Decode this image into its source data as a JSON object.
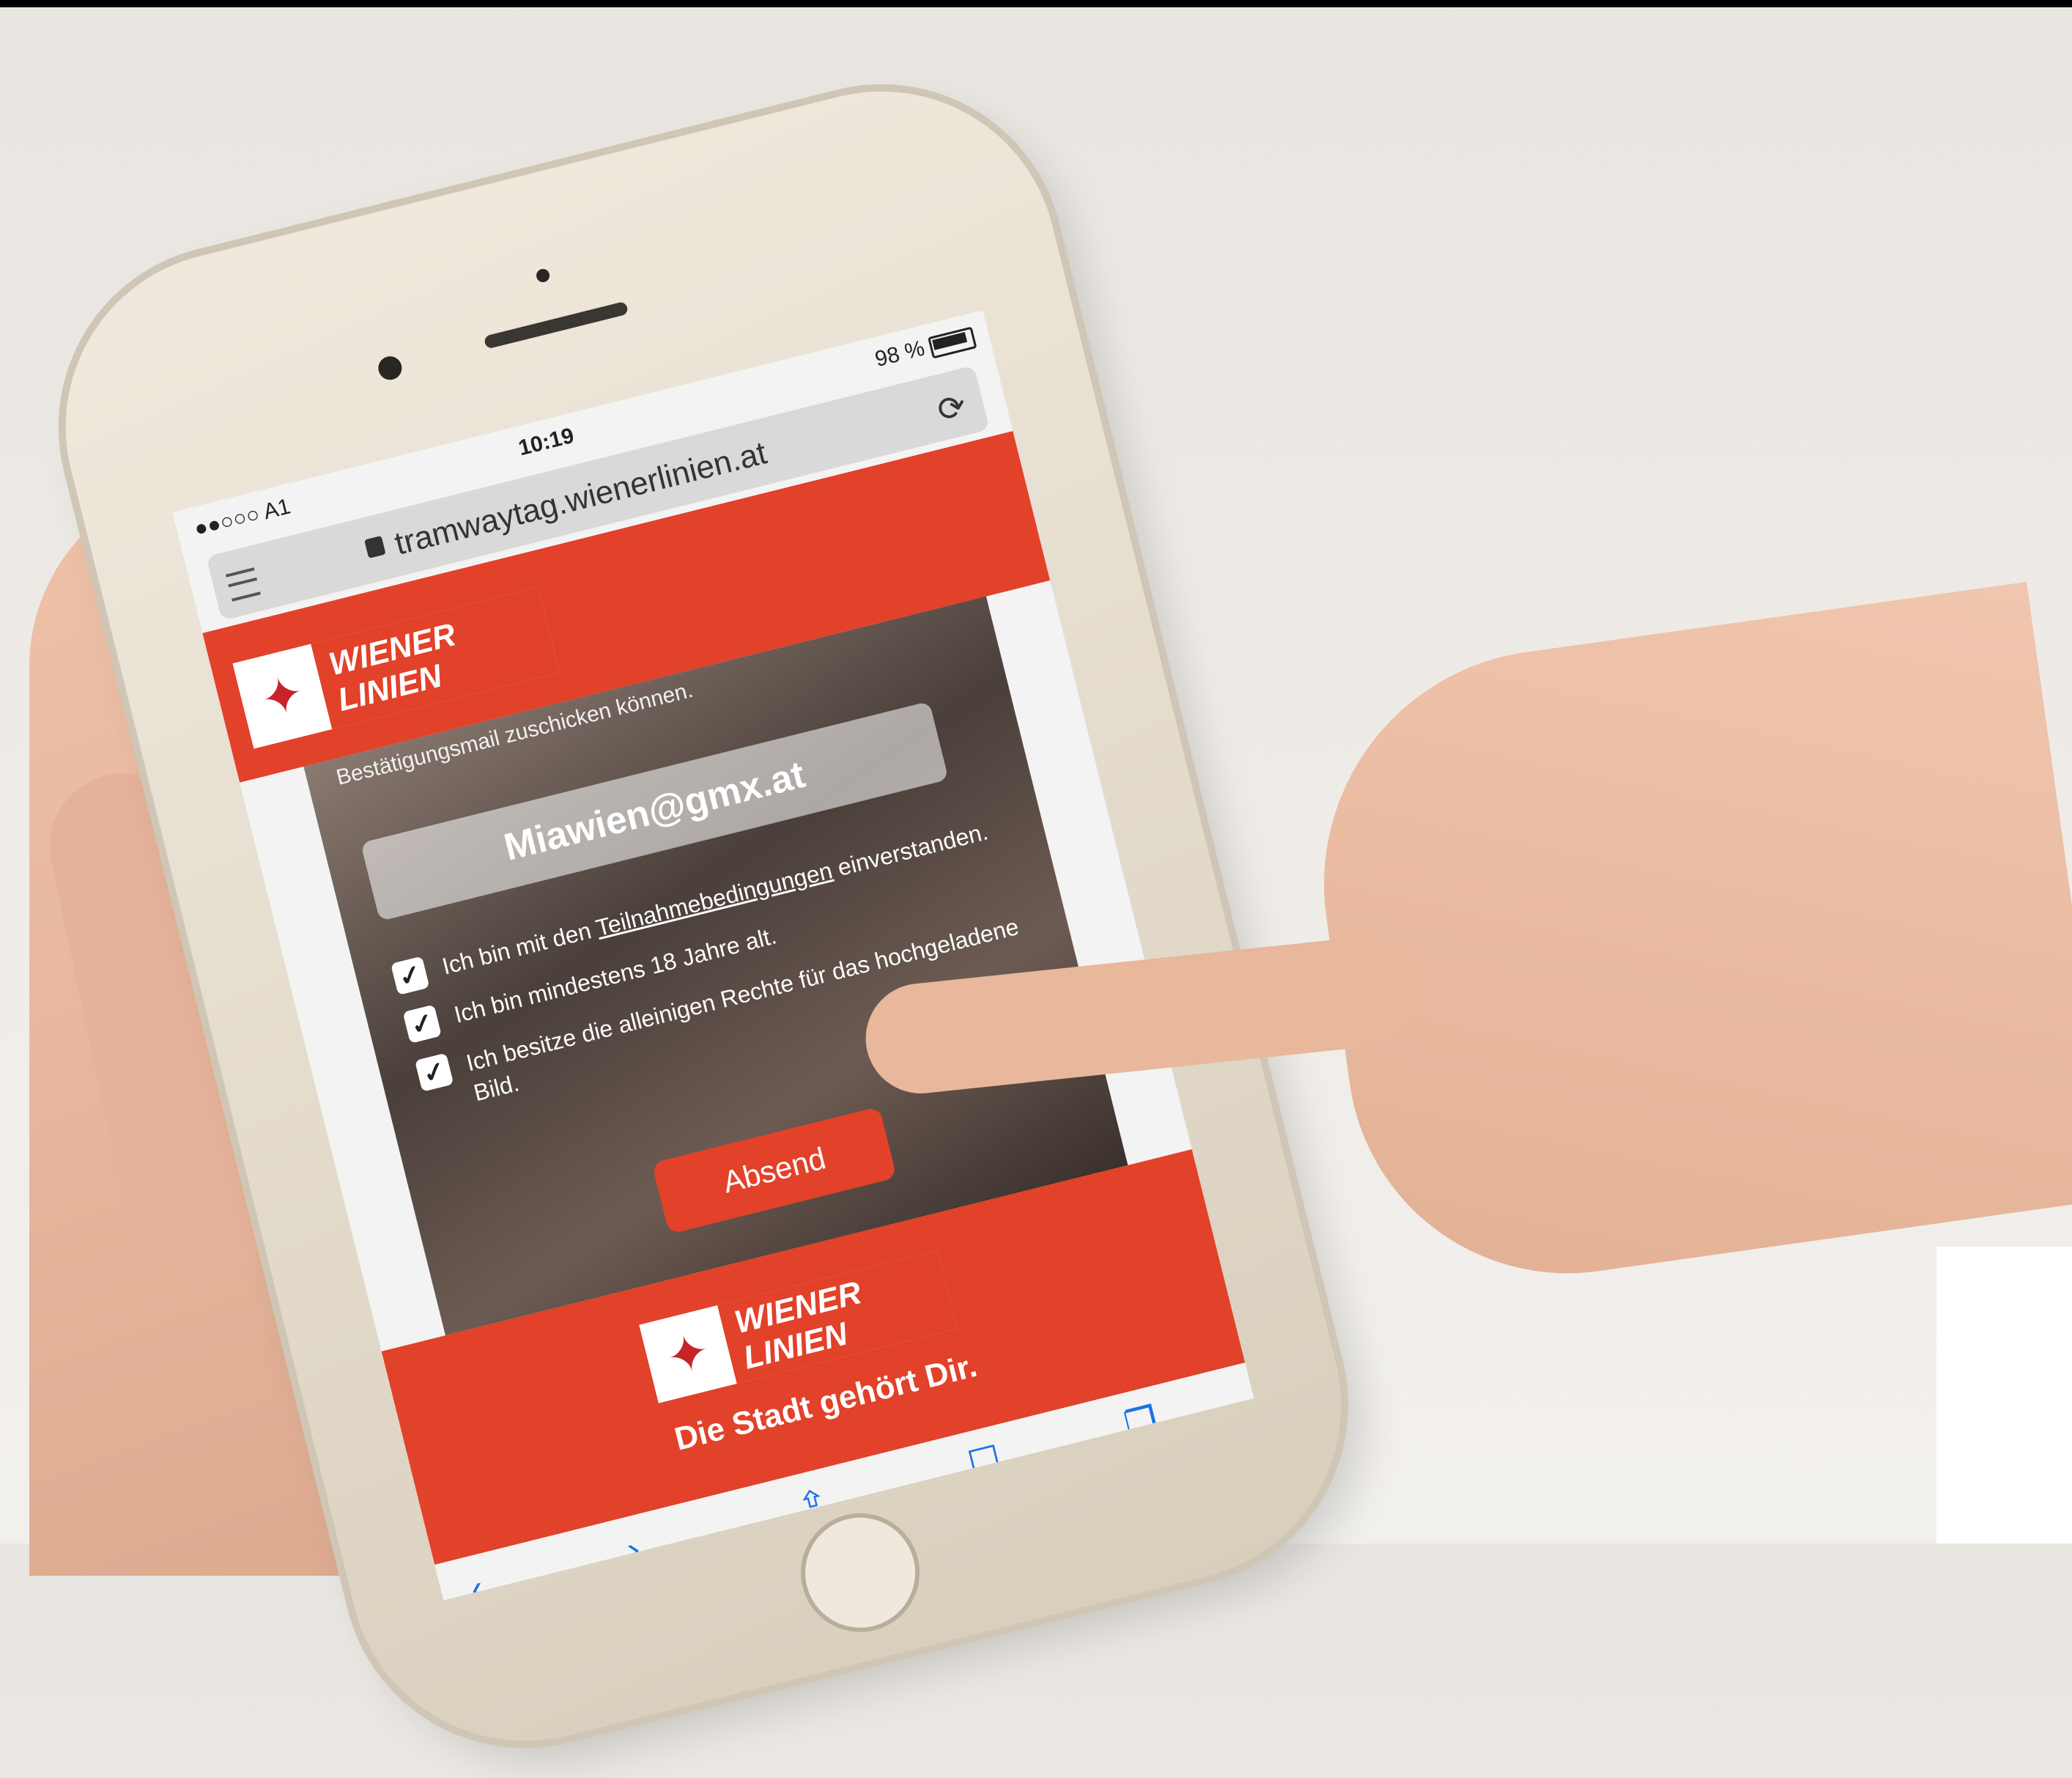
{
  "statusbar": {
    "carrier": "●●○○○ A1",
    "time": "10:19",
    "battery": "98 %"
  },
  "browser": {
    "url": "tramwaytag.wienerlinien.at",
    "menu_icon": "hamburger-icon",
    "lock_icon": "lock-icon",
    "reload_icon": "reload-icon"
  },
  "header": {
    "logo_text": "WIENER LINIEN"
  },
  "form": {
    "caption": "Bestätigungsmail zuschicken können.",
    "email_value": "Miawien@gmx.at",
    "checkbox_1_prefix": "Ich bin mit den ",
    "checkbox_1_link": "Teilnahmebedingungen",
    "checkbox_1_suffix": " einverstanden.",
    "checkbox_2": "Ich bin mindestens 18 Jahre alt.",
    "checkbox_3": "Ich besitze die alleinigen Rechte für das hochgeladene Bild.",
    "submit_label": "Absend"
  },
  "footer": {
    "logo_text": "WIENER LINIEN",
    "slogan": "Die Stadt gehört Dir."
  },
  "toolbar": {
    "icons": [
      "back-icon",
      "forward-icon",
      "share-icon",
      "bookmarks-icon",
      "tabs-icon"
    ]
  },
  "colors": {
    "brand_red": "#e2412a",
    "link_blue": "#1a73e8"
  }
}
